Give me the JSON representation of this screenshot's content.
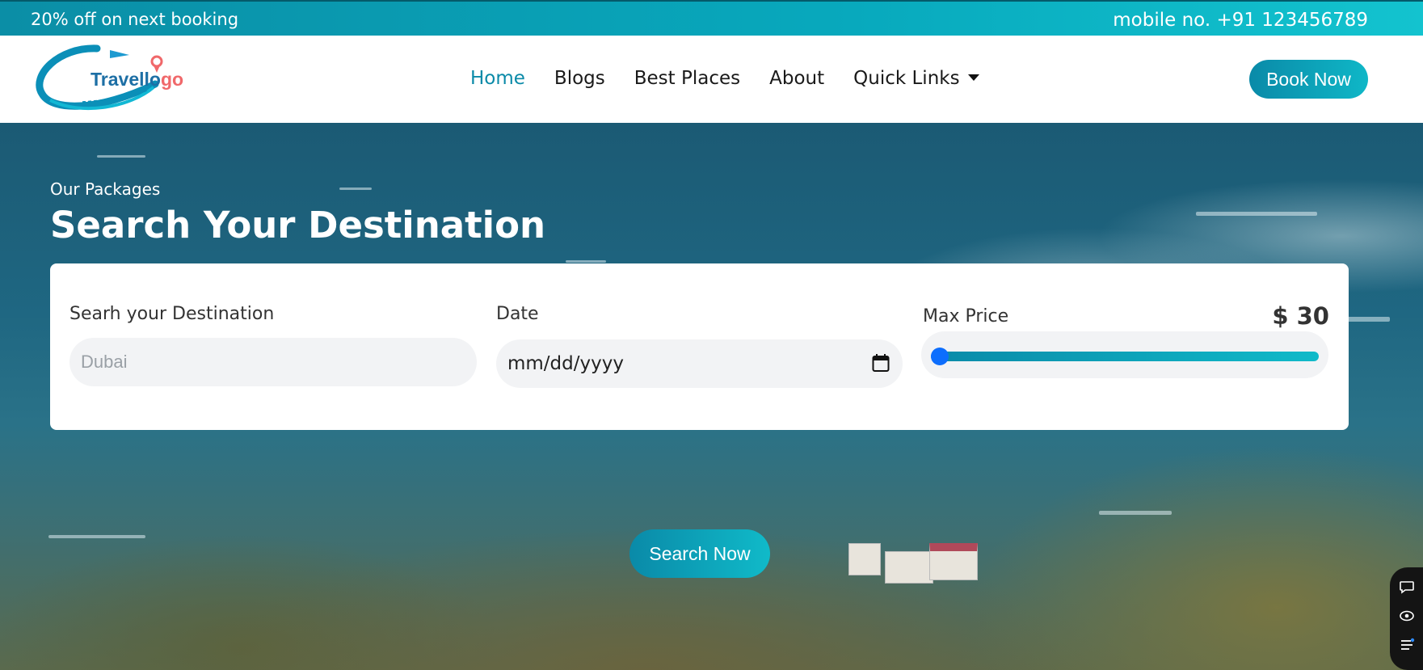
{
  "topbar": {
    "promo": "20% off on next booking",
    "phone": "mobile no. +91 123456789"
  },
  "logo": {
    "brand": "Travello",
    "brand_accent": "go",
    "accent_color": "#f0686a",
    "brand_color": "#1d6fa5"
  },
  "nav": {
    "items": [
      {
        "label": "Home",
        "active": true
      },
      {
        "label": "Blogs"
      },
      {
        "label": "Best Places"
      },
      {
        "label": "About"
      },
      {
        "label": "Quick Links",
        "has_dropdown": true
      }
    ],
    "cta": "Book Now"
  },
  "hero": {
    "eyebrow": "Our Packages",
    "title": "Search Your Destination"
  },
  "search": {
    "destination_label": "Searh your Destination",
    "destination_placeholder": "Dubai",
    "date_label": "Date",
    "date_value": "mm/dd/yyyy",
    "price_label": "Max Price",
    "price_value": "$ 30",
    "price_fraction": 0.0,
    "button": "Search Now"
  },
  "colors": {
    "accent": "#0a8aa8",
    "accent_light": "#10bac9",
    "slider_thumb": "#0d6efd"
  },
  "side_tools": [
    "chat-icon",
    "eye-icon",
    "menu-icon"
  ]
}
